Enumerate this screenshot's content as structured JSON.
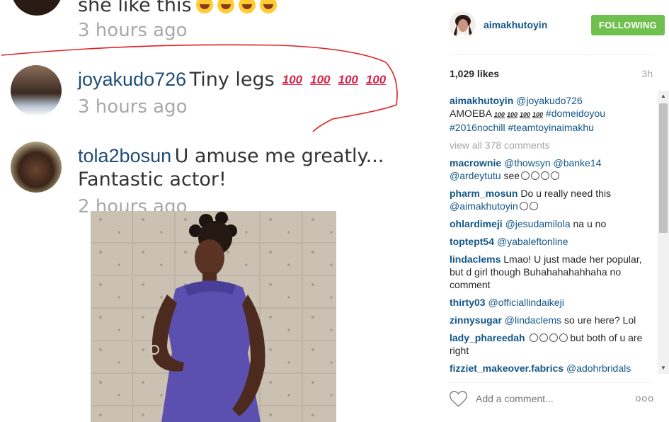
{
  "screenshot": {
    "top_row": {
      "text": "she like this",
      "time": "3 hours ago"
    },
    "row2": {
      "user": "joyakudo726",
      "text": "Tiny legs",
      "hundreds": [
        "100",
        "100",
        "100",
        "100"
      ],
      "time": "3 hours ago"
    },
    "row3": {
      "user": "tola2bosun",
      "text": "U amuse me greatly...",
      "text2": "Fantastic actor!",
      "time": "2 hours ago"
    }
  },
  "header": {
    "username": "aimakhutoyin",
    "follow_label": "FOLLOWING"
  },
  "stats": {
    "likes": "1,029 likes",
    "ago": "3h"
  },
  "comments": [
    {
      "user": "aimakhutoyin",
      "mention": "@joyakudo726",
      "text": "AMOEBA",
      "hundreds": [
        "100",
        "100",
        "100",
        "100"
      ],
      "tags": "#domeidoyou #2016nochill #teamtoyinaimakhu"
    },
    {
      "viewall": "view all 378 comments"
    },
    {
      "user": "macrownie",
      "mention": "@thowsyn @banke14 @ardeytutu",
      "text": "see"
    },
    {
      "user": "pharm_mosun",
      "text": "Do u really need this",
      "mention": "@aimakhutoyin"
    },
    {
      "user": "ohlardimeji",
      "mention": "@jesudamilola",
      "text": "na u no"
    },
    {
      "user": "toptept54",
      "mention": "@yabaleftonline"
    },
    {
      "user": "lindaclems",
      "text": "Lmao! U just made her popular, but d girl though Buhahahahahhaha no comment"
    },
    {
      "user": "thirty03",
      "mention": "@officiallindaikeji"
    },
    {
      "user": "zinnysugar",
      "mention": "@lindaclems",
      "text": "so ure here? Lol"
    },
    {
      "user": "lady_phareedah",
      "text": "but both of u are right"
    },
    {
      "user": "fizziet_makeover.fabrics",
      "mention": "@adohrbridals"
    }
  ],
  "add_comment": {
    "placeholder": "Add a comment...",
    "more": "ooo"
  },
  "colors": {
    "link": "#125688",
    "follow": "#70c050",
    "muted": "#a5a7aa",
    "annotation": "#e02020"
  }
}
